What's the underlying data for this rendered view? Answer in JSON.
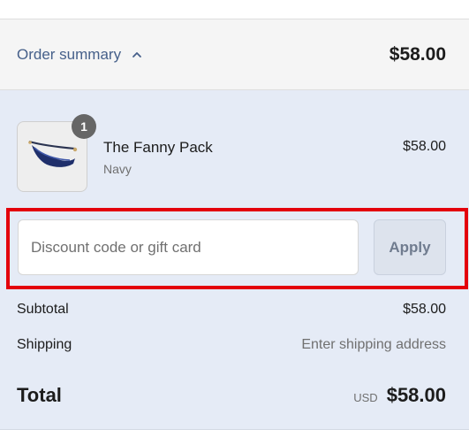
{
  "summary_toggle": {
    "label": "Order summary",
    "icon": "chevron-up-icon",
    "total": "$58.00"
  },
  "product": {
    "quantity": "1",
    "name": "The Fanny Pack",
    "variant": "Navy",
    "price": "$58.00",
    "image": "fanny-pack-image"
  },
  "discount": {
    "placeholder": "Discount code or gift card",
    "value": "",
    "apply_label": "Apply"
  },
  "totals": {
    "subtotal_label": "Subtotal",
    "subtotal_value": "$58.00",
    "shipping_label": "Shipping",
    "shipping_value": "Enter shipping address",
    "total_label": "Total",
    "currency": "USD",
    "total_value": "$58.00"
  },
  "colors": {
    "link": "#46608a",
    "panel_background": "#e5ebf6",
    "highlight_border": "#e3000b",
    "badge": "#666666"
  }
}
